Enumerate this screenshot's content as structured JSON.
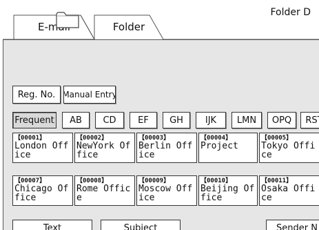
{
  "tabs": [
    {
      "label": "E-mail",
      "active": false
    },
    {
      "label": "Folder",
      "active": true
    }
  ],
  "folder_panel": {
    "destination_label": "Folder D"
  },
  "buttons": {
    "reg_no": "Reg. No.",
    "manual_entry": "Manual Entry"
  },
  "index_tabs": [
    {
      "label": "Frequent",
      "selected": true
    },
    {
      "label": "AB",
      "selected": false
    },
    {
      "label": "CD",
      "selected": false
    },
    {
      "label": "EF",
      "selected": false
    },
    {
      "label": "GH",
      "selected": false
    },
    {
      "label": "IJK",
      "selected": false
    },
    {
      "label": "LMN",
      "selected": false
    },
    {
      "label": "OPQ",
      "selected": false
    },
    {
      "label": "RST",
      "selected": false
    }
  ],
  "entries": [
    {
      "number": "【00001】",
      "name": "London Office"
    },
    {
      "number": "【00002】",
      "name": "NewYork Office"
    },
    {
      "number": "【00003】",
      "name": "Berlin Office"
    },
    {
      "number": "【00004】",
      "name": "Project"
    },
    {
      "number": "【00005】",
      "name": "Tokyo Office"
    },
    {
      "number": "【00007】",
      "name": "Chicago Office"
    },
    {
      "number": "【00008】",
      "name": "Rome Office"
    },
    {
      "number": "【00009】",
      "name": "Moscow Office"
    },
    {
      "number": "【00010】",
      "name": "Beijing Office"
    },
    {
      "number": "【00011】",
      "name": "Osaka Office"
    }
  ],
  "bottom_buttons": {
    "text": "Text",
    "subject": "Subject",
    "sender": "Sender N"
  }
}
